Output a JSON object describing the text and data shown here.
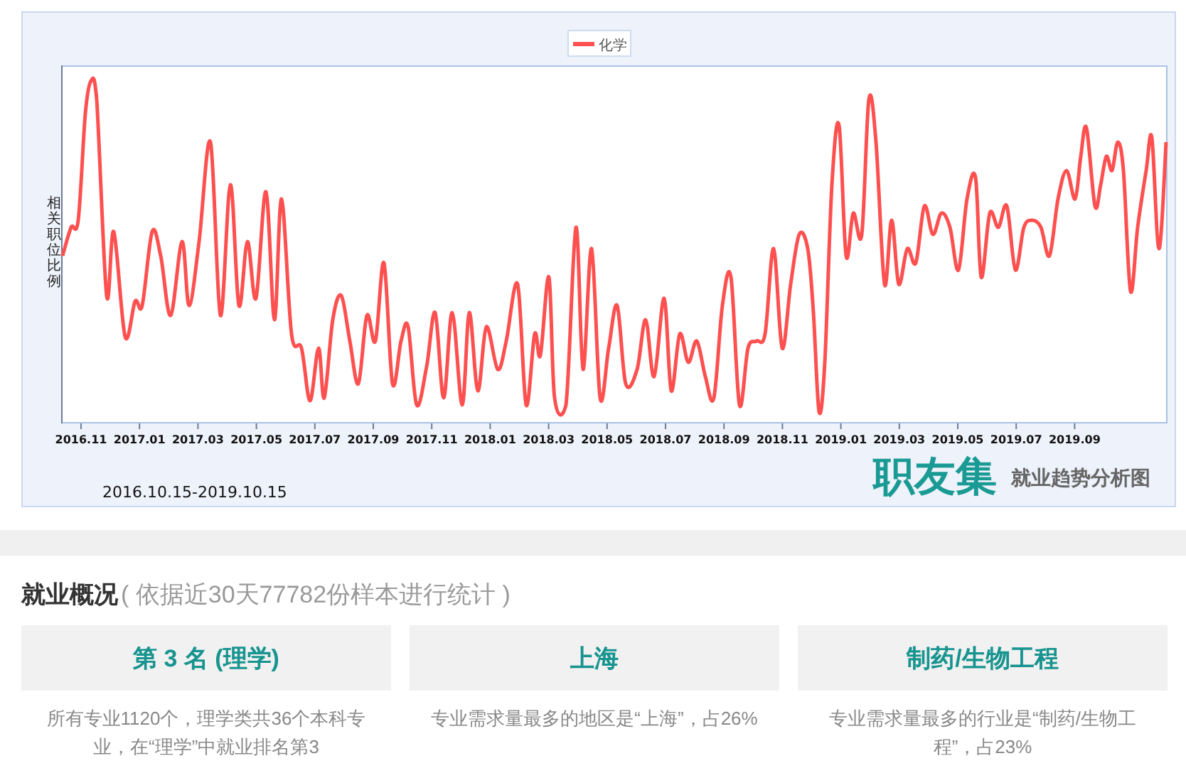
{
  "chart": {
    "legend": "化学",
    "y_label": "相关职位比例",
    "x_ticks": [
      "2016.11",
      "2017.01",
      "2017.03",
      "2017.05",
      "2017.07",
      "2017.09",
      "2017.11",
      "2018.01",
      "2018.03",
      "2018.05",
      "2018.07",
      "2018.09",
      "2018.11",
      "2019.01",
      "2019.03",
      "2019.05",
      "2019.07",
      "2019.09"
    ],
    "date_range": "2016.10.15-2019.10.15",
    "logo": "职友集",
    "logo_subtitle": "就业趋势分析图"
  },
  "overview": {
    "title": "就业概况",
    "note": "( 依据近30天77782份样本进行统计 )",
    "cards": [
      {
        "headline": "第 3 名 (理学)",
        "description": "所有专业1120个，理学类共36个本科专业，在“理学”中就业排名第3"
      },
      {
        "headline": "上海",
        "description": "专业需求量最多的地区是“上海”，占26%"
      },
      {
        "headline": "制药/生物工程",
        "description": "专业需求量最多的行业是“制药/生物工程”，占23%"
      }
    ]
  }
}
